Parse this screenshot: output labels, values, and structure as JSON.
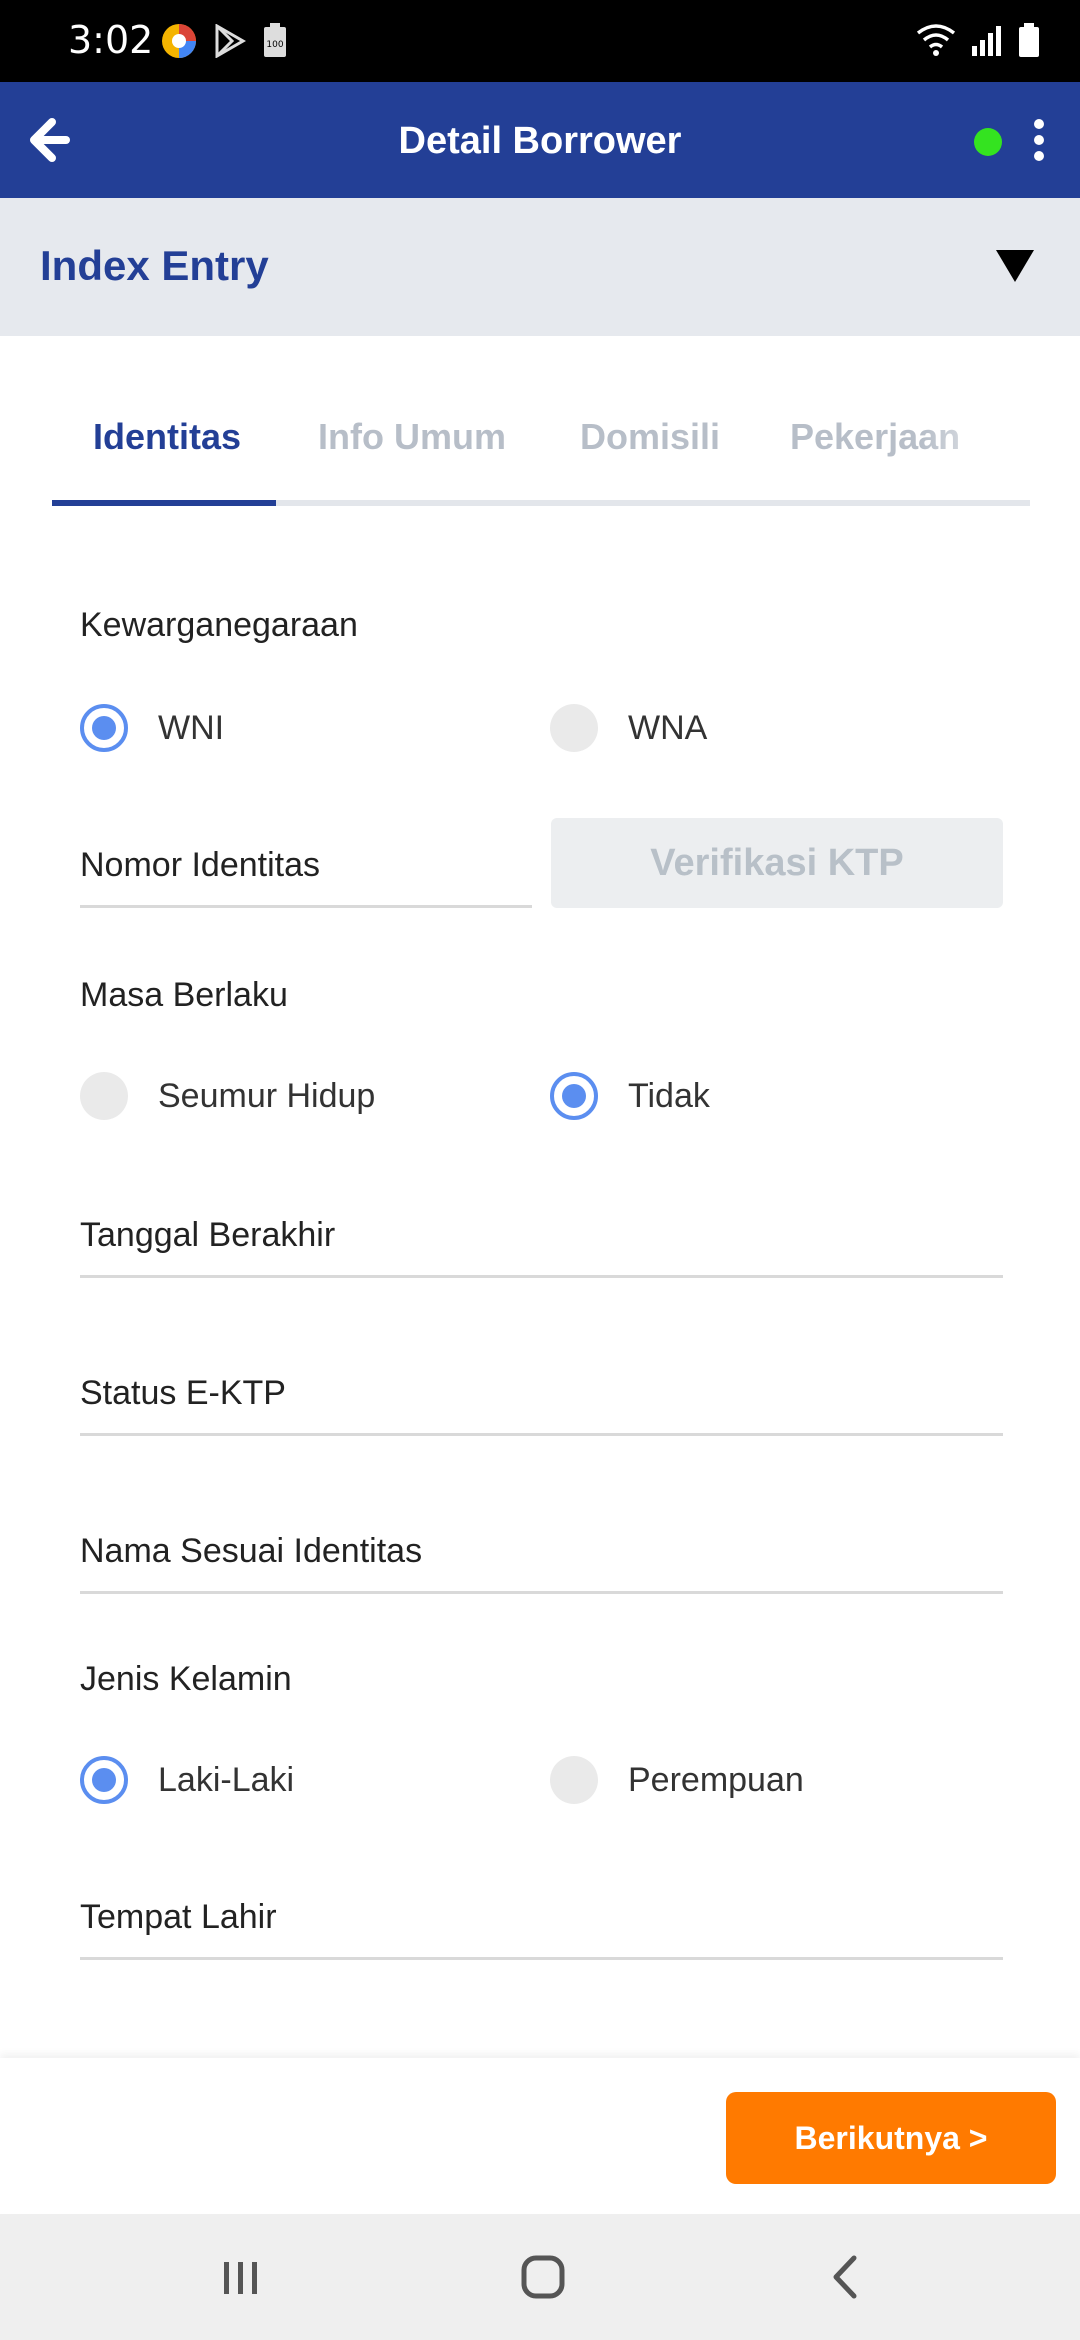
{
  "status_bar": {
    "time": "3:02",
    "left_icons": [
      "photos-icon",
      "play-store-icon",
      "battery-saver-icon"
    ],
    "right_icons": [
      "wifi-icon",
      "signal-icon",
      "battery-icon"
    ]
  },
  "app_bar": {
    "title": "Detail Borrower",
    "online_color": "#34e320"
  },
  "index_entry": {
    "label": "Index Entry"
  },
  "tabs": {
    "items": [
      {
        "label": "Identitas",
        "active": true
      },
      {
        "label": "Info Umum",
        "active": false
      },
      {
        "label": "Domisili",
        "active": false
      },
      {
        "label": "Pekerjaan",
        "active": false
      }
    ]
  },
  "form": {
    "citizenship": {
      "label": "Kewarganegaraan",
      "options": [
        "WNI",
        "WNA"
      ],
      "selected": "WNI"
    },
    "id_number": {
      "label": "Nomor Identitas",
      "verify_button": "Verifikasi KTP"
    },
    "validity": {
      "label": "Masa Berlaku",
      "options": [
        "Seumur Hidup",
        "Tidak"
      ],
      "selected": "Tidak"
    },
    "end_date": {
      "label": "Tanggal Berakhir"
    },
    "ektp_status": {
      "label": "Status E-KTP"
    },
    "name": {
      "label": "Nama Sesuai Identitas"
    },
    "gender": {
      "label": "Jenis Kelamin",
      "options": [
        "Laki-Laki",
        "Perempuan"
      ],
      "selected": "Laki-Laki"
    },
    "birthplace": {
      "label": "Tempat Lahir"
    }
  },
  "footer": {
    "next_button": "Berikutnya >"
  },
  "colors": {
    "primary": "#233f96",
    "accent": "#ff7a00",
    "radio": "#5b8ef0"
  }
}
